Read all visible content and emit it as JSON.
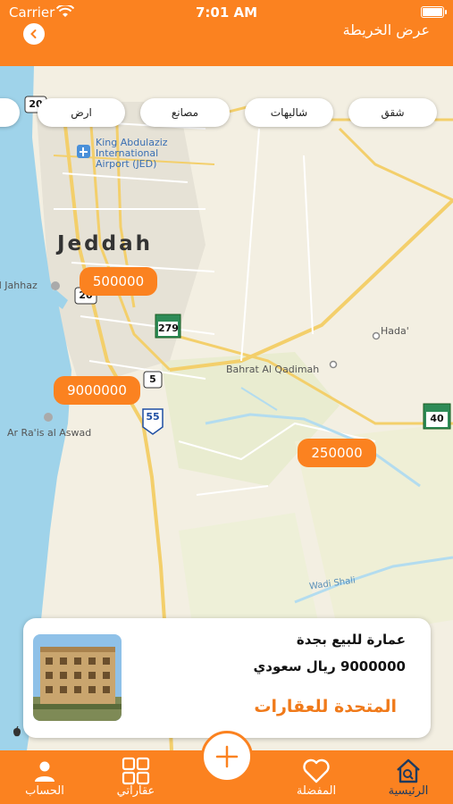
{
  "status": {
    "carrier": "Carrier",
    "time": "7:01 AM"
  },
  "header": {
    "title": "عرض الخريطة"
  },
  "filters": [
    "شقق",
    "شاليهات",
    "مصانع",
    "ارض"
  ],
  "map": {
    "labels": {
      "city": "Jeddah",
      "airport": "King Abdulaziz International Airport (JED)",
      "bahrat": "Bahrat Al Qadimah",
      "hada": "Hada'",
      "jahhaz": "al Jahhaz",
      "raisalaswad": "Ar Ra'is al Aswad",
      "wadishali": "Wadi Shali"
    },
    "shields": {
      "r20top": "20",
      "r20": "20",
      "r279": "279",
      "r5": "5",
      "r55": "55",
      "r40": "40"
    },
    "prices": [
      "500000",
      "9000000",
      "250000"
    ]
  },
  "card": {
    "title": "عمارة للبيع بجدة",
    "price": "9000000 ريال سعودي",
    "company": "المتحدة للعقارات"
  },
  "tabs": {
    "home": "الرئيسية",
    "favorites": "المفضلة",
    "properties": "عقاراتي",
    "account": "الحساب"
  },
  "colors": {
    "primary": "#fb8220",
    "active_tab": "#1e3a5f",
    "water": "#9fd3ea",
    "map_bg": "#f3efe2"
  }
}
